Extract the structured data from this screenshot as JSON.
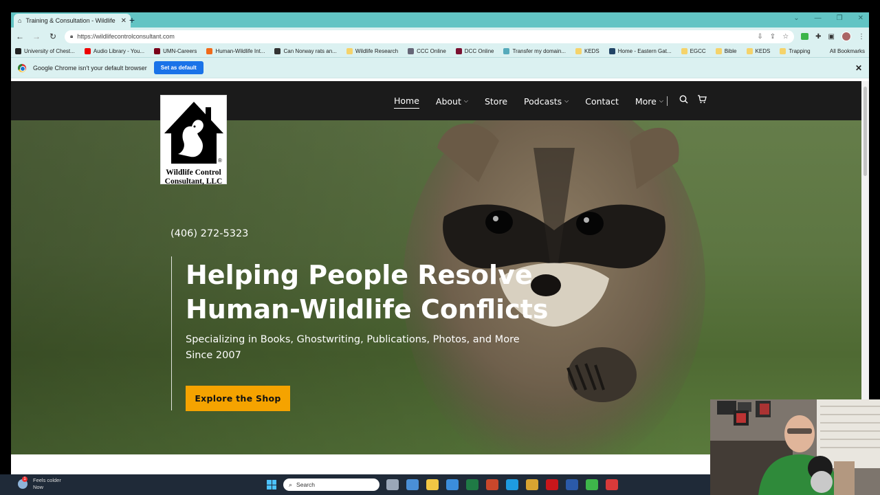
{
  "browser": {
    "tab_title": "Training & Consultation - Wildlife",
    "new_tab": "+",
    "url": "https://wildlifecontrolconsultant.com",
    "bookmarks": [
      {
        "label": "University of Chest...",
        "color": "#222"
      },
      {
        "label": "Audio Library - You...",
        "color": "#e00"
      },
      {
        "label": "UMN-Careers",
        "color": "#7a0019"
      },
      {
        "label": "Human-Wildlife Int...",
        "color": "#f06a1a"
      },
      {
        "label": "Can Norway rats an...",
        "color": "#333"
      },
      {
        "label": "Wildlife Research",
        "color": "folder"
      },
      {
        "label": "CCC Online",
        "color": "#667"
      },
      {
        "label": "DCC Online",
        "color": "#7a1030"
      },
      {
        "label": "Transfer my domain...",
        "color": "#5ab"
      },
      {
        "label": "KEDS",
        "color": "folder"
      },
      {
        "label": "Home - Eastern Gat...",
        "color": "#246"
      },
      {
        "label": "EGCC",
        "color": "folder"
      },
      {
        "label": "Bible",
        "color": "folder"
      },
      {
        "label": "KEDS",
        "color": "folder"
      },
      {
        "label": "Trapping",
        "color": "folder"
      }
    ],
    "all_bookmarks": "All Bookmarks",
    "infobar_text": "Google Chrome isn't your default browser",
    "set_default": "Set as default"
  },
  "site": {
    "nav": [
      {
        "label": "Home",
        "active": true,
        "dropdown": false
      },
      {
        "label": "About",
        "active": false,
        "dropdown": true
      },
      {
        "label": "Store",
        "active": false,
        "dropdown": false
      },
      {
        "label": "Podcasts",
        "active": false,
        "dropdown": true
      },
      {
        "label": "Contact",
        "active": false,
        "dropdown": false
      },
      {
        "label": "More",
        "active": false,
        "dropdown": true
      }
    ],
    "logo_line1": "Wildlife Control",
    "logo_line2": "Consultant, LLC",
    "logo_mark": "®",
    "phone": "(406) 272-5323",
    "headline_1": "Helping People Resolve",
    "headline_2": "Human-Wildlife Conflicts",
    "subhead_1": "Specializing in Books, Ghostwriting, Publications, Photos, and More",
    "subhead_2": "Since 2007",
    "cta": "Explore the Shop",
    "accent": "#f5a300",
    "nav_bg": "#1b1b1b"
  },
  "taskbar": {
    "weather_1": "Feels colder",
    "weather_2": "Now",
    "badge": "1",
    "search_placeholder": "Search",
    "apps": [
      "task-view",
      "widgets",
      "file-explorer",
      "mail",
      "excel",
      "powerpoint",
      "edge",
      "chrome",
      "acrobat",
      "word",
      "camtasia",
      "camtasia-recorder"
    ]
  }
}
